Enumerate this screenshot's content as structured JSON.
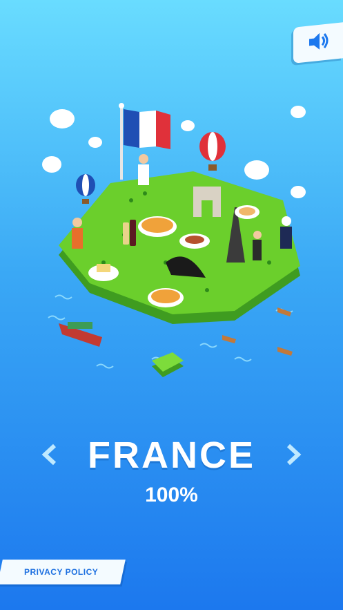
{
  "header": {
    "sound_icon": "speaker-icon"
  },
  "country": {
    "name": "FRANCE",
    "progress": "100%"
  },
  "navigation": {
    "prev_icon": "chevron-left-icon",
    "next_icon": "chevron-right-icon"
  },
  "footer": {
    "privacy_label": "PRIVACY POLICY"
  },
  "colors": {
    "accent": "#1c78ee",
    "flag_blue": "#1f4fb4",
    "flag_red": "#e0313a",
    "land": "#6bcf2c"
  }
}
